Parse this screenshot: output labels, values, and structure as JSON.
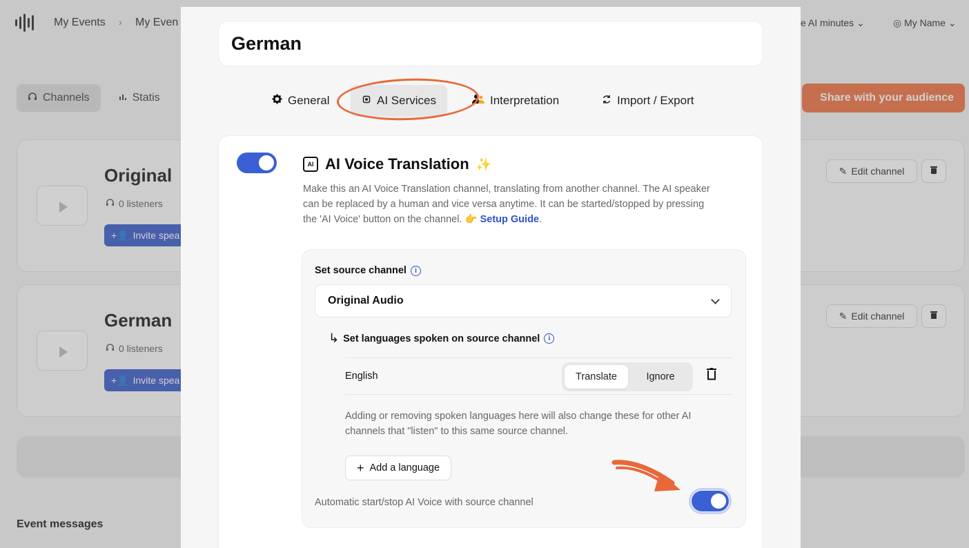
{
  "header": {
    "breadcrumb": [
      "My Events",
      "My Even"
    ],
    "minutes_label": "e AI minutes",
    "user_label": "My Name"
  },
  "page_tabs": [
    {
      "label": "Channels",
      "icon": "headphones-icon",
      "active": true
    },
    {
      "label": "Statis",
      "icon": "stats-icon",
      "active": false
    }
  ],
  "share_label": "Share with your audience",
  "channels": [
    {
      "title": "Original",
      "listeners": "0 listeners",
      "invite": "Invite spea",
      "edit": "Edit channel"
    },
    {
      "title": "German",
      "listeners": "0 listeners",
      "invite": "Invite spea",
      "edit": "Edit channel"
    }
  ],
  "event_messages_label": "Event messages",
  "modal": {
    "title": "German",
    "tabs": [
      {
        "label": "General",
        "icon": "gear-icon"
      },
      {
        "label": "AI Services",
        "icon": "chip-icon",
        "active": true
      },
      {
        "label": "Interpretation",
        "icon": "people-icon"
      },
      {
        "label": "Import / Export",
        "icon": "sync-icon"
      }
    ],
    "feature": {
      "enabled": true,
      "chip_text": "AI",
      "title": "AI Voice Translation",
      "sparkle": "✨",
      "description": "Make this an AI Voice Translation channel, translating from another channel. The AI speaker can be replaced by a human and vice versa anytime. It can be started/stopped by pressing the 'AI Voice' button on the channel.",
      "guide_emoji": "👉",
      "guide_link": "Setup Guide",
      "guide_suffix": "."
    },
    "source": {
      "label": "Set source channel",
      "selected": "Original Audio",
      "languages_label": "Set languages spoken on source channel",
      "arrow": "↳",
      "languages": [
        {
          "name": "English",
          "mode": "Translate",
          "alt_mode": "Ignore"
        }
      ],
      "note": "Adding or removing spoken languages here will also change these for other AI channels that \"listen\" to this same source channel.",
      "add_language": "Add a language",
      "auto_label": "Automatic start/stop AI Voice with source channel",
      "auto_enabled": true
    }
  },
  "colors": {
    "accent_blue": "#3a5fd6",
    "brand_orange": "#f06a3a",
    "annotation_orange": "#e8683a"
  }
}
